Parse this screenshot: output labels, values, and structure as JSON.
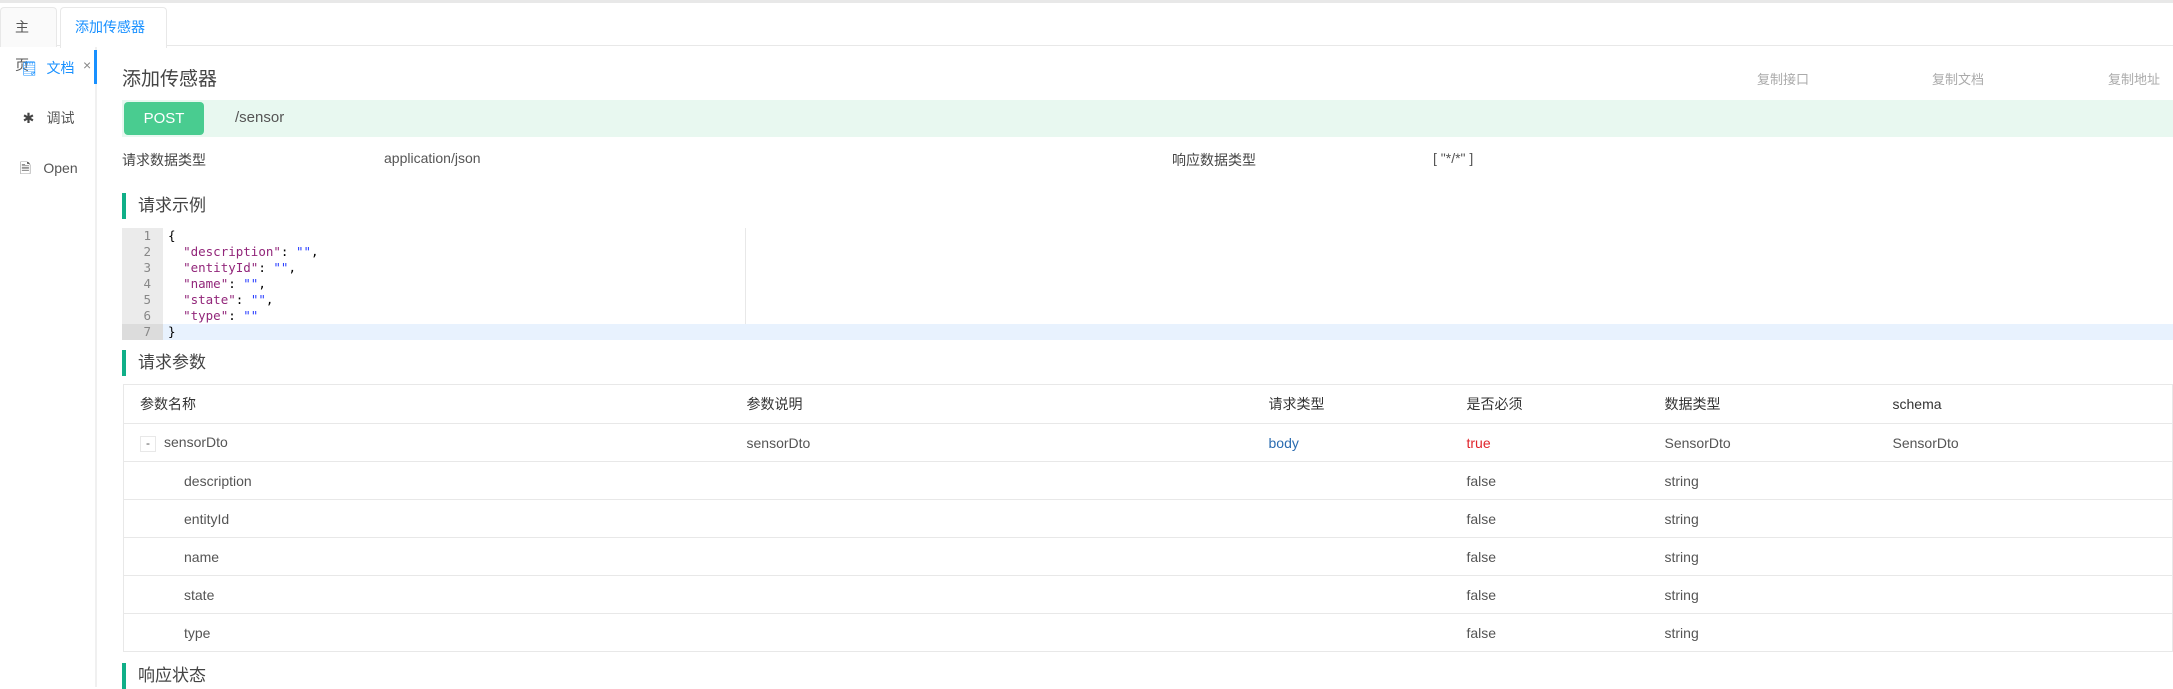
{
  "tabs": [
    {
      "label": "主页"
    },
    {
      "label": "添加传感器",
      "close": "×"
    }
  ],
  "sidebar": {
    "items": [
      {
        "label": "文档",
        "icon": "document-icon"
      },
      {
        "label": "调试",
        "icon": "bug-icon"
      },
      {
        "label": "Open",
        "icon": "file-icon"
      }
    ]
  },
  "page": {
    "title": "添加传感器",
    "copy_interface": "复制接口",
    "copy_doc": "复制文档",
    "copy_address": "复制地址"
  },
  "endpoint": {
    "method": "POST",
    "path": "/sensor"
  },
  "meta": {
    "req_type_label": "请求数据类型",
    "req_type": "application/json",
    "resp_type_label": "响应数据类型",
    "resp_type": "[ \"*/*\" ]"
  },
  "sections": {
    "example": "请求示例",
    "params": "请求参数",
    "response": "响应状态"
  },
  "code": {
    "lines": [
      [
        "1",
        "{"
      ],
      [
        "2",
        "  \"description\": \"\","
      ],
      [
        "3",
        "  \"entityId\": \"\","
      ],
      [
        "4",
        "  \"name\": \"\","
      ],
      [
        "5",
        "  \"state\": \"\","
      ],
      [
        "6",
        "  \"type\": \"\""
      ],
      [
        "7",
        "}"
      ]
    ]
  },
  "table": {
    "headers": [
      "参数名称",
      "参数说明",
      "请求类型",
      "是否必须",
      "数据类型",
      "schema"
    ],
    "parent": {
      "toggle": "-",
      "name": "sensorDto",
      "desc": "sensorDto",
      "in": "body",
      "required": "true",
      "type": "SensorDto",
      "schema": "SensorDto"
    },
    "children": [
      {
        "name": "description",
        "required": "false",
        "type": "string"
      },
      {
        "name": "entityId",
        "required": "false",
        "type": "string"
      },
      {
        "name": "name",
        "required": "false",
        "type": "string"
      },
      {
        "name": "state",
        "required": "false",
        "type": "string"
      },
      {
        "name": "type",
        "required": "false",
        "type": "string"
      }
    ]
  },
  "colors": {
    "accent": "#1890ff",
    "post": "#49cc90",
    "section": "#10af88"
  }
}
